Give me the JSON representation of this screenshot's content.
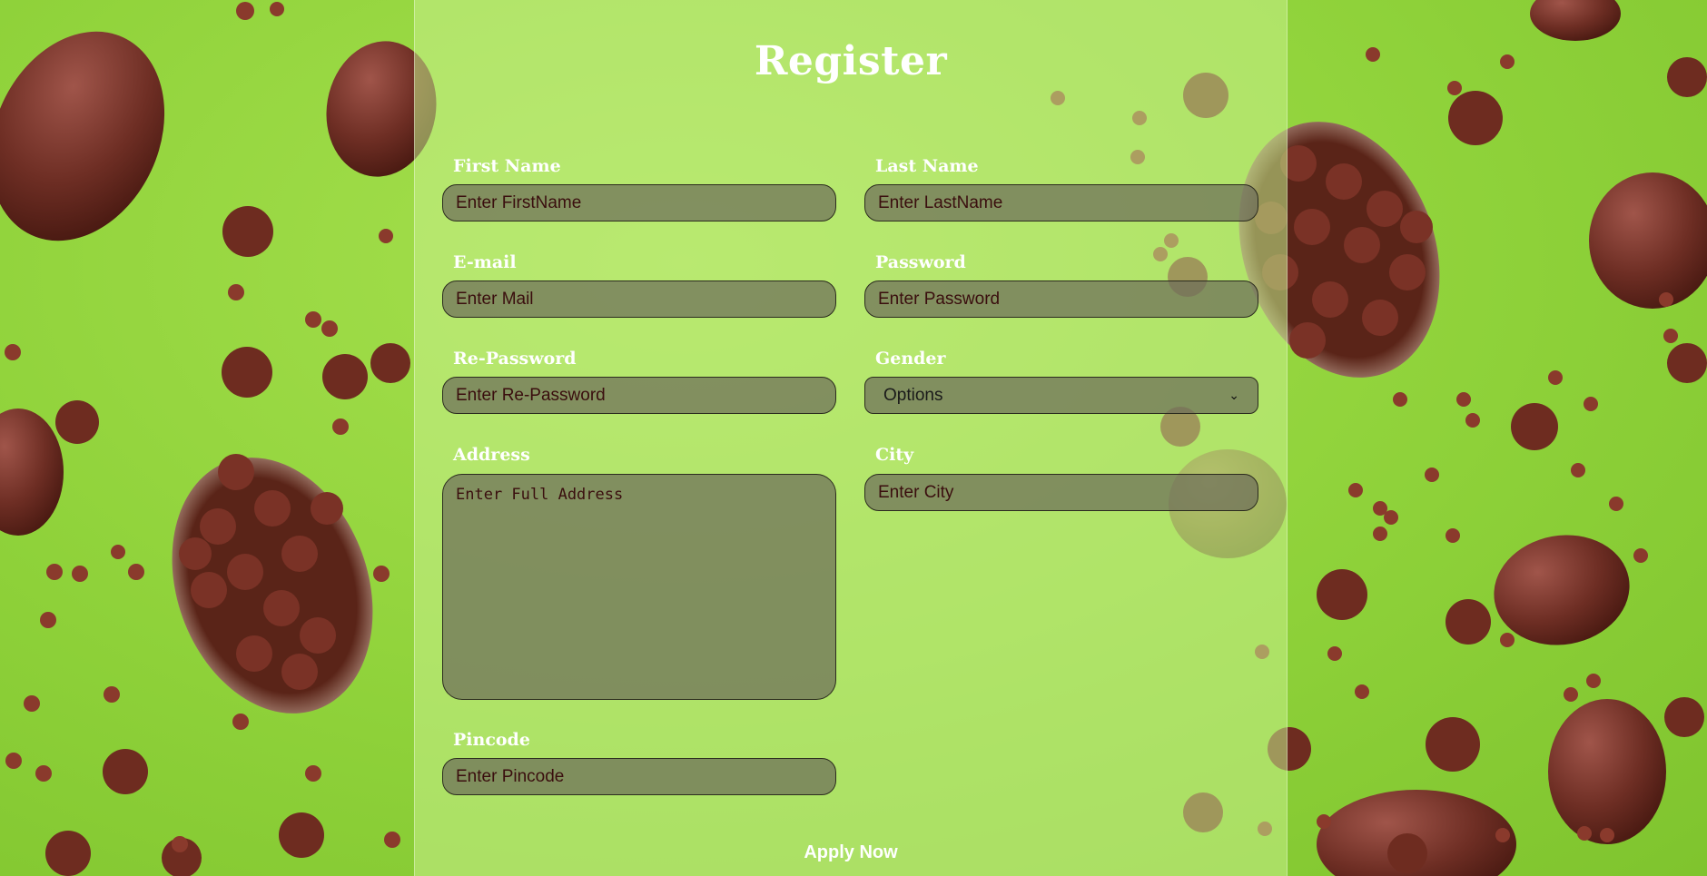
{
  "page": {
    "title": "Register",
    "background_color": "#8fd23a",
    "background_image": "chocolate-eggs-on-green"
  },
  "form": {
    "first_name": {
      "label": "First Name",
      "placeholder": "Enter FirstName"
    },
    "last_name": {
      "label": "Last Name",
      "placeholder": "Enter LastName"
    },
    "email": {
      "label": "E-mail",
      "placeholder": "Enter Mail"
    },
    "password": {
      "label": "Password",
      "placeholder": "Enter Password"
    },
    "re_password": {
      "label": "Re-Password",
      "placeholder": "Enter Re-Password"
    },
    "gender": {
      "label": "Gender",
      "selected": "Options"
    },
    "address": {
      "label": "Address",
      "placeholder": "Enter Full Address"
    },
    "city": {
      "label": "City",
      "placeholder": "Enter City"
    },
    "pincode": {
      "label": "Pincode",
      "placeholder": "Enter Pincode"
    },
    "submit_label": "Apply Now"
  },
  "colors": {
    "field_bg": "#6e6e5a",
    "label_text": "#ffffff",
    "placeholder_text": "#3a0e0e"
  }
}
